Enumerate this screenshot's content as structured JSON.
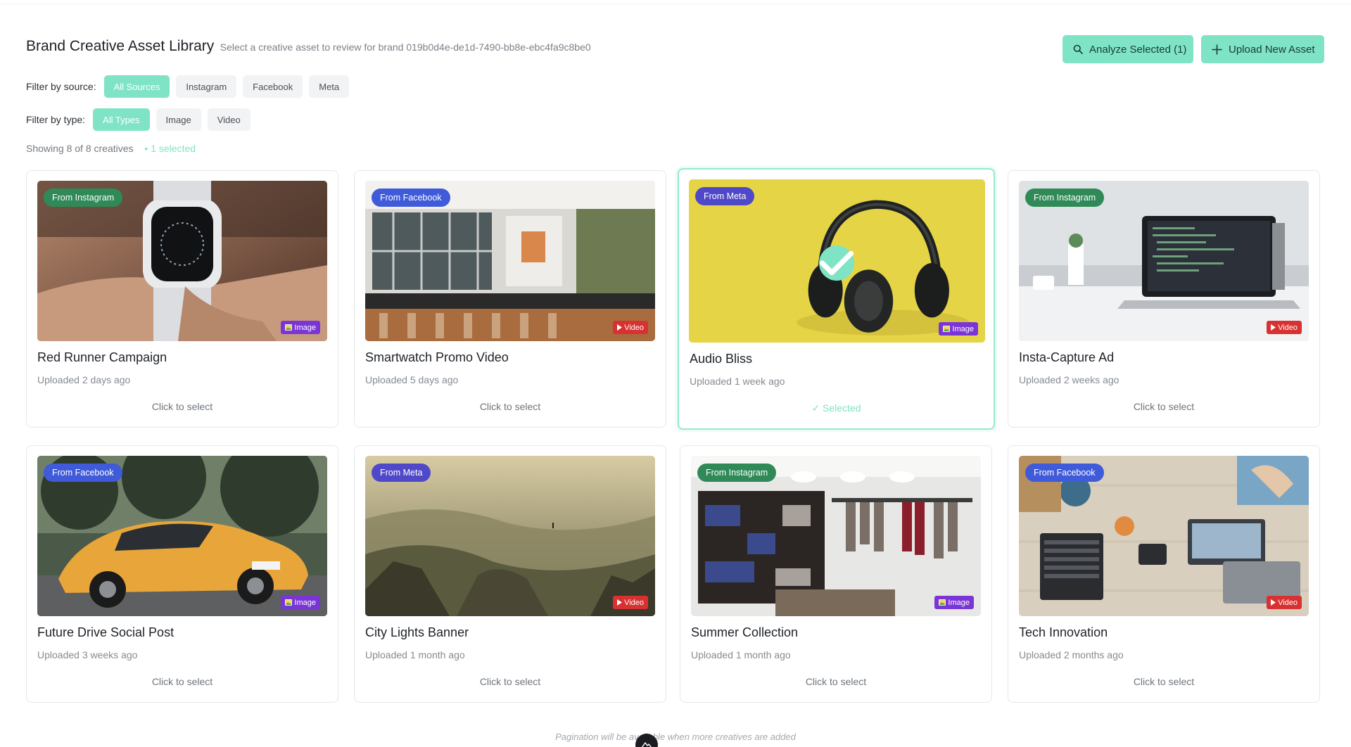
{
  "header": {
    "title": "Brand Creative Asset Library",
    "subtitle": "Select a creative asset to review for brand 019b0d4e-de1d-7490-bb8e-ebc4fa9c8be0",
    "analyze_label": "Analyze Selected (1)",
    "upload_label": "Upload New Asset"
  },
  "filters": {
    "source_label": "Filter by source:",
    "sources": [
      "All Sources",
      "Instagram",
      "Facebook",
      "Meta"
    ],
    "source_active": "All Sources",
    "type_label": "Filter by type:",
    "types": [
      "All Types",
      "Image",
      "Video"
    ],
    "type_active": "All Types"
  },
  "status": {
    "showing": "Showing 8 of 8 creatives",
    "selected": "• 1 selected"
  },
  "cards": [
    {
      "title": "Red Runner Campaign",
      "uploaded": "Uploaded 2 days ago",
      "source": "From Instagram",
      "source_kind": "instagram",
      "type": "Image",
      "type_kind": "image",
      "action": "Click to select",
      "selected": false,
      "art": "watch"
    },
    {
      "title": "Smartwatch Promo Video",
      "uploaded": "Uploaded 5 days ago",
      "source": "From Facebook",
      "source_kind": "facebook",
      "type": "Video",
      "type_kind": "video",
      "action": "Click to select",
      "selected": false,
      "art": "cafe"
    },
    {
      "title": "Audio Bliss",
      "uploaded": "Uploaded 1 week ago",
      "source": "From Meta",
      "source_kind": "meta",
      "type": "Image",
      "type_kind": "image",
      "action": "✓ Selected",
      "selected": true,
      "art": "headphones"
    },
    {
      "title": "Insta-Capture Ad",
      "uploaded": "Uploaded 2 weeks ago",
      "source": "From Instagram",
      "source_kind": "instagram",
      "type": "Video",
      "type_kind": "video",
      "action": "Click to select",
      "selected": false,
      "art": "laptop"
    },
    {
      "title": "Future Drive Social Post",
      "uploaded": "Uploaded 3 weeks ago",
      "source": "From Facebook",
      "source_kind": "facebook",
      "type": "Image",
      "type_kind": "image",
      "action": "Click to select",
      "selected": false,
      "art": "car"
    },
    {
      "title": "City Lights Banner",
      "uploaded": "Uploaded 1 month ago",
      "source": "From Meta",
      "source_kind": "meta",
      "type": "Video",
      "type_kind": "video",
      "action": "Click to select",
      "selected": false,
      "art": "mountains"
    },
    {
      "title": "Summer Collection",
      "uploaded": "Uploaded 1 month ago",
      "source": "From Instagram",
      "source_kind": "instagram",
      "type": "Image",
      "type_kind": "image",
      "action": "Click to select",
      "selected": false,
      "art": "store"
    },
    {
      "title": "Tech Innovation",
      "uploaded": "Uploaded 2 months ago",
      "source": "From Facebook",
      "source_kind": "facebook",
      "type": "Video",
      "type_kind": "video",
      "action": "Click to select",
      "selected": false,
      "art": "desk"
    }
  ],
  "pagination": "Pagination will be available when more creatives are added",
  "colors": {
    "accent": "#7fe3c5",
    "instagram": "#2f8a57",
    "facebook": "#3f5bd9",
    "meta": "#4f49c9",
    "image_badge": "#7b35d7",
    "video_badge": "#d83131"
  }
}
